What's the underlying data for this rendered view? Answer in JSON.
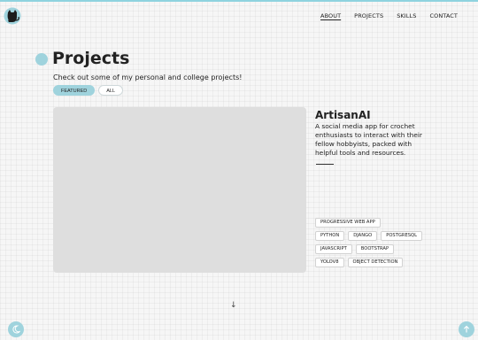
{
  "colors": {
    "accent": "#9fd3dd",
    "topbar": "#8fd3df",
    "preview": "#dedede"
  },
  "logo": {
    "icon": "cat-icon"
  },
  "nav": {
    "items": [
      {
        "label": "ABOUT",
        "active": true
      },
      {
        "label": "PROJECTS"
      },
      {
        "label": "SKILLS"
      },
      {
        "label": "CONTACT"
      }
    ]
  },
  "header": {
    "title": "Projects",
    "subtitle": "Check out some of my personal and college projects!"
  },
  "filters": [
    {
      "label": "FEATURED",
      "active": true
    },
    {
      "label": "ALL"
    }
  ],
  "project": {
    "name": "ArtisanAI",
    "description": "A social media app for crochet enthusiasts to interact with their fellow hobbyists, packed with helpful tools and resources.",
    "tags": [
      [
        "PROGRESSIVE WEB APP"
      ],
      [
        "PYTHON",
        "DJANGO",
        "POSTGRESQL"
      ],
      [
        "JAVASCRIPT",
        "BOOTSTRAP"
      ],
      [
        "YOLOV8",
        "OBJECT DETECTION"
      ]
    ]
  },
  "scroll_hint": "↓",
  "fabs": {
    "left_icon": "moon-icon",
    "right_icon": "arrow-up-icon"
  }
}
